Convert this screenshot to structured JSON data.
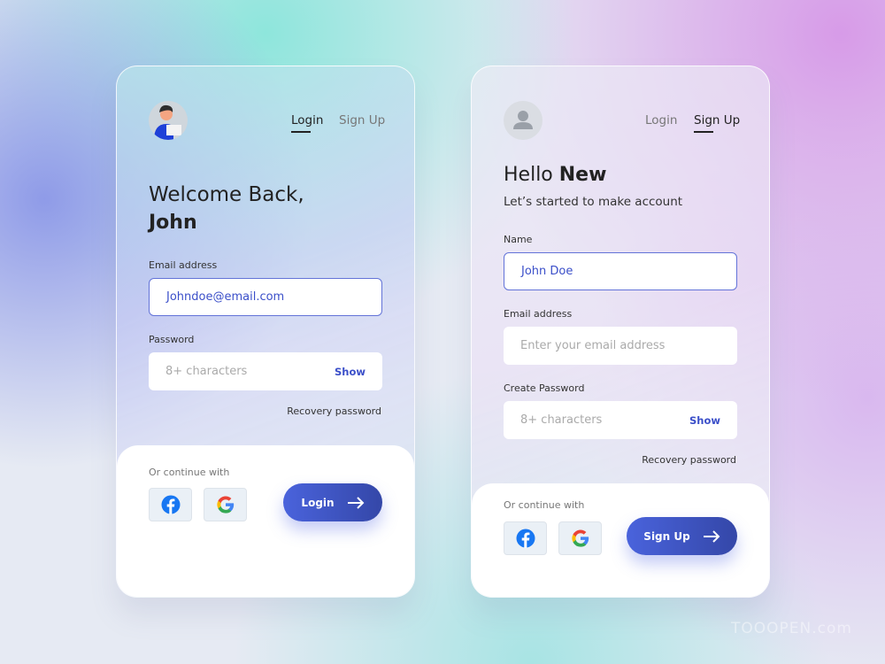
{
  "login_card": {
    "tabs": [
      {
        "label": "Login",
        "active": true
      },
      {
        "label": "Sign Up",
        "active": false
      }
    ],
    "title_line1": "Welcome Back,",
    "title_line2": "John",
    "email_label": "Email address",
    "email_value": "Johndoe@email.com",
    "password_label": "Password",
    "password_placeholder": "8+ characters",
    "show_label": "Show",
    "recovery": "Recovery password",
    "continue_with": "Or continue with",
    "submit": "Login"
  },
  "signup_card": {
    "tabs": [
      {
        "label": "Login",
        "active": false
      },
      {
        "label": "Sign Up",
        "active": true
      }
    ],
    "title_regular": "Hello ",
    "title_bold": "New",
    "subtitle": "Let’s started to make account",
    "name_label": "Name",
    "name_value": "John Doe",
    "email_label": "Email address",
    "email_placeholder": "Enter your email address",
    "password_label": "Create Password",
    "password_placeholder": "8+ characters",
    "show_label": "Show",
    "recovery": "Recovery password",
    "continue_with": "Or continue with",
    "submit": "Sign Up"
  },
  "icons": [
    "user-avatar",
    "facebook-icon",
    "google-icon",
    "arrow-right-icon"
  ],
  "colors": {
    "accent": "#3b4fc9",
    "facebook": "#1877f2"
  },
  "watermark": "TOOOPEN.com"
}
